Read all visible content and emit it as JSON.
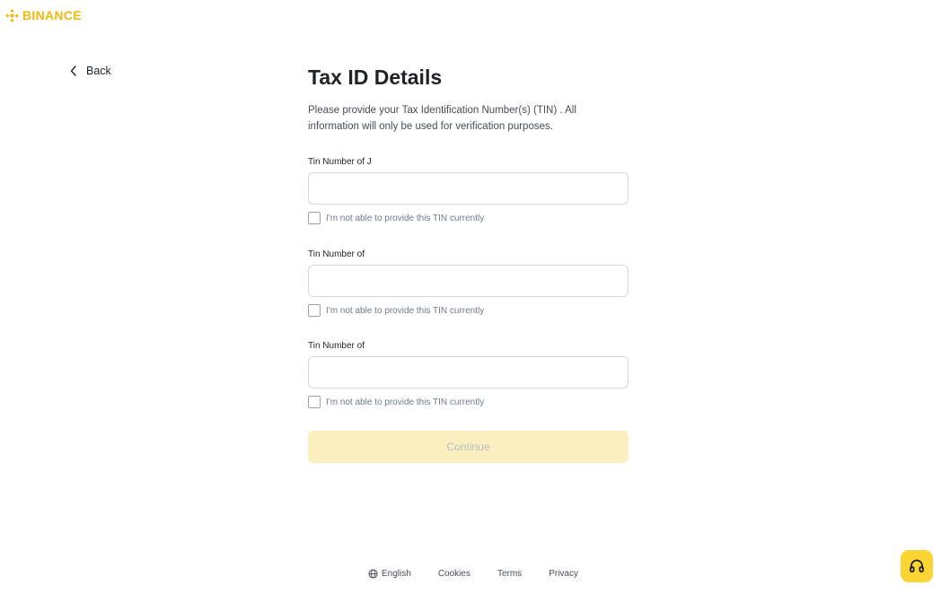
{
  "brand": {
    "name": "BINANCE",
    "color": "#f0b90b"
  },
  "nav": {
    "back_label": "Back"
  },
  "form": {
    "title": "Tax ID Details",
    "description": "Please provide your Tax Identification Number(s) (TIN) . All information will only be used for verification purposes.",
    "fields": [
      {
        "label": "Tin Number of J",
        "value": "",
        "checkbox_label": "I'm not able to provide this TIN currently",
        "checked": false
      },
      {
        "label": "Tin Number of",
        "value": "",
        "checkbox_label": "I'm not able to provide this TIN currently",
        "checked": false
      },
      {
        "label": "Tin Number of",
        "value": "",
        "checkbox_label": "I'm not able to provide this TIN currently",
        "checked": false
      }
    ],
    "continue_label": "Continue"
  },
  "footer": {
    "language": "English",
    "links": [
      "Cookies",
      "Terms",
      "Privacy"
    ]
  },
  "support": {
    "icon": "headset-icon",
    "color": "#fcd535"
  }
}
